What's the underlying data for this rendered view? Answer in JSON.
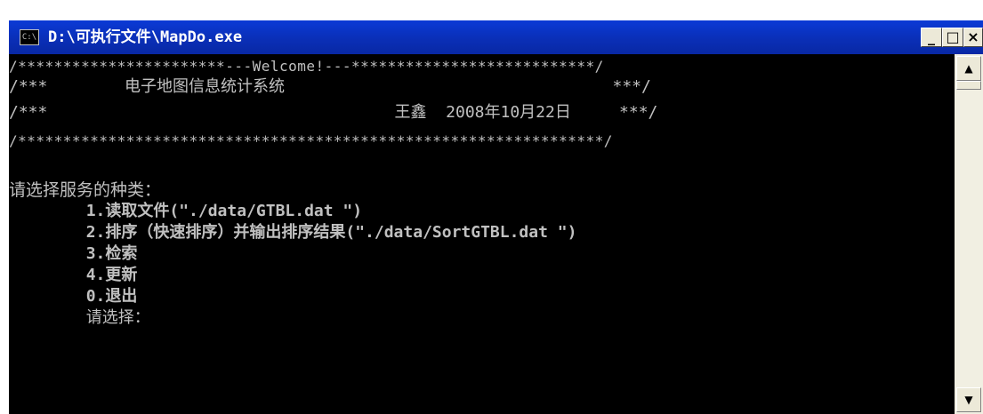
{
  "window": {
    "title": "D:\\可执行文件\\MapDo.exe",
    "icon_text": "C:\\",
    "controls": {
      "minimize": "_",
      "maximize": "□",
      "close": "×"
    }
  },
  "console": {
    "lines": [
      "/***********************---Welcome!---***************************/",
      "/***        电子地图信息统计系统                                  ***/",
      "/***                                    王鑫  2008年10月22日     ***/",
      "/*****************************************************************/",
      "",
      "请选择服务的种类：",
      "        1.读取文件(\"./data/GTBL.dat \")",
      "        2.排序（快速排序）并输出排序结果(\"./data/SortGTBL.dat \")",
      "        3.检索",
      "        4.更新",
      "        0.退出",
      "        请选择："
    ]
  },
  "scrollbar": {
    "up_icon": "scroll-up-arrow",
    "down_icon": "scroll-down-arrow"
  }
}
